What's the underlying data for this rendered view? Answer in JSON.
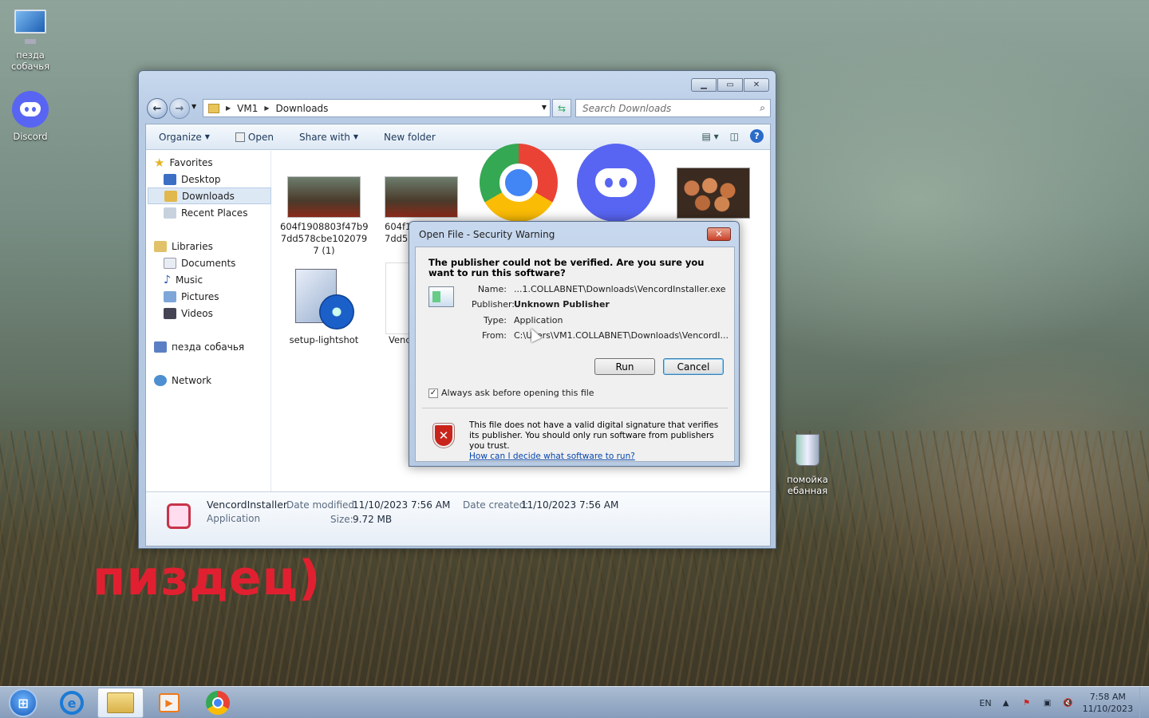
{
  "desktop": {
    "icons": [
      {
        "label": "пезда собачья",
        "icon": "computer-icon"
      },
      {
        "label": "Discord",
        "icon": "discord-icon"
      },
      {
        "label": "помойка ебанная",
        "icon": "recycle-bin-icon"
      }
    ],
    "overlay_text": "пиздец)"
  },
  "explorer": {
    "breadcrumb": [
      "VM1",
      "Downloads"
    ],
    "search_placeholder": "Search Downloads",
    "toolbar": {
      "organize": "Organize",
      "open": "Open",
      "share_with": "Share with",
      "new_folder": "New folder"
    },
    "nav": {
      "favorites": "Favorites",
      "desktop": "Desktop",
      "downloads": "Downloads",
      "recent_places": "Recent Places",
      "libraries": "Libraries",
      "documents": "Documents",
      "music": "Music",
      "pictures": "Pictures",
      "videos": "Videos",
      "homegroup": "пезда собачья",
      "network": "Network"
    },
    "files": [
      {
        "name": "604f1908803f47b97dd578cbe102079 7 (1)",
        "line1": "604f1908803f47b9",
        "line2": "7dd578cbe102079",
        "line3": "7 (1)"
      },
      {
        "line1": "604f19",
        "line2": "7dd57"
      },
      {
        "name": "chrome"
      },
      {
        "name": "discord"
      },
      {
        "name": "eggs"
      },
      {
        "name": "setup-lightshot"
      },
      {
        "name": "Venc"
      }
    ],
    "details": {
      "name": "VencordInstaller",
      "type": "Application",
      "date_modified_label": "Date modified:",
      "date_modified": "11/10/2023 7:56 AM",
      "date_created_label": "Date created:",
      "date_created": "11/10/2023 7:56 AM",
      "size_label": "Size:",
      "size": "9.72 MB"
    }
  },
  "dialog": {
    "title": "Open File - Security Warning",
    "heading": "The publisher could not be verified.  Are you sure you want to run this software?",
    "name_label": "Name:",
    "name_value": "...1.COLLABNET\\Downloads\\VencordInstaller.exe",
    "publisher_label": "Publisher:",
    "publisher_value": "Unknown Publisher",
    "type_label": "Type:",
    "type_value": "Application",
    "from_label": "From:",
    "from_value": "C:\\Users\\VM1.COLLABNET\\Downloads\\VencordI...",
    "run": "Run",
    "cancel": "Cancel",
    "always_ask": "Always ask before opening this file",
    "always_ask_checked": true,
    "warning_text": "This file does not have a valid digital signature that verifies its publisher.  You should only run software from publishers you trust.",
    "warning_link": "How can I decide what software to run?"
  },
  "taskbar": {
    "language": "EN",
    "time": "7:58 AM",
    "date": "11/10/2023"
  }
}
